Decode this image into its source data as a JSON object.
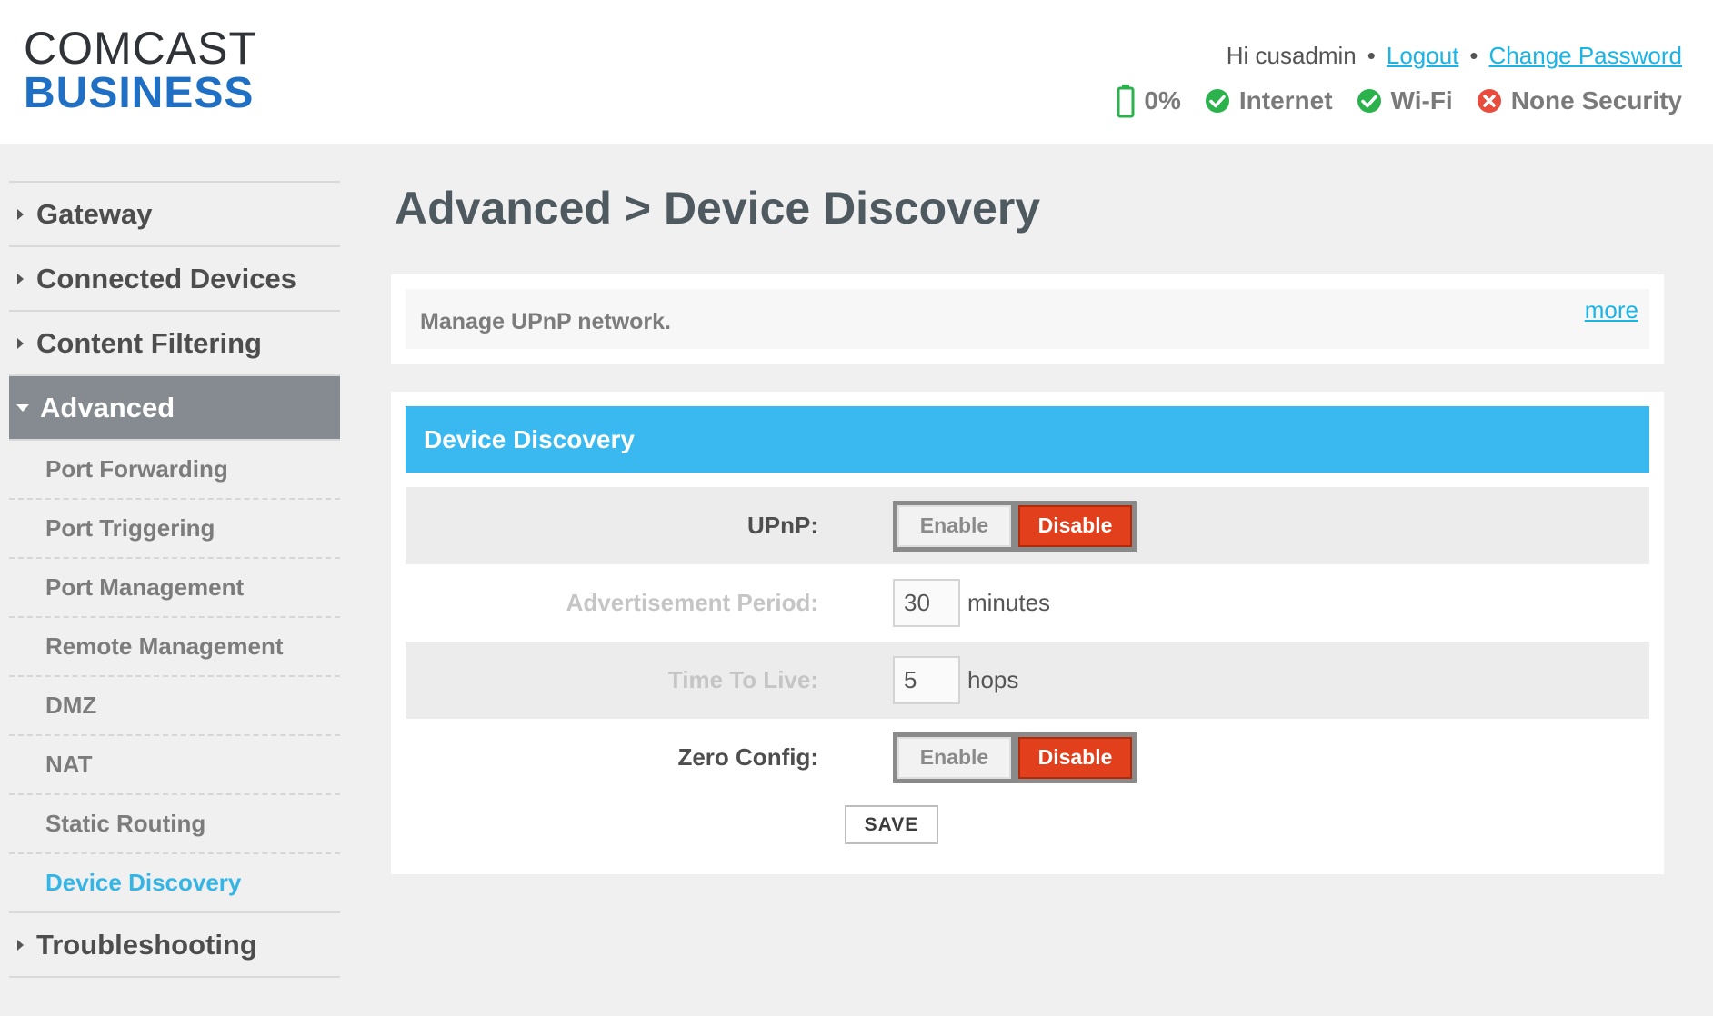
{
  "header": {
    "logo_top": "COMCAST",
    "logo_bottom": "BUSINESS",
    "greeting": "Hi cusadmin",
    "logout": "Logout",
    "change_password": "Change Password",
    "battery": "0%",
    "internet": "Internet",
    "wifi": "Wi-Fi",
    "security": "None Security",
    "colors": {
      "ok": "#2bb24c",
      "error": "#e74c3c",
      "battery": "#2bb24c"
    }
  },
  "sidebar": {
    "items": [
      {
        "label": "Gateway"
      },
      {
        "label": "Connected Devices"
      },
      {
        "label": "Content Filtering"
      },
      {
        "label": "Advanced"
      },
      {
        "label": "Troubleshooting"
      }
    ],
    "advanced_sub": [
      "Port Forwarding",
      "Port Triggering",
      "Port Management",
      "Remote Management",
      "DMZ",
      "NAT",
      "Static Routing",
      "Device Discovery"
    ]
  },
  "main": {
    "title": "Advanced > Device Discovery",
    "info": "Manage UPnP network.",
    "more": "more",
    "panel_title": "Device Discovery",
    "upnp_label": "UPnP:",
    "adv_label": "Advertisement Period:",
    "adv_value": "30",
    "adv_unit": "minutes",
    "ttl_label": "Time To Live:",
    "ttl_value": "5",
    "ttl_unit": "hops",
    "zero_label": "Zero Config:",
    "enable": "Enable",
    "disable": "Disable",
    "save": "SAVE",
    "accent": "#39b9ef",
    "disable_color": "#e2401c"
  }
}
